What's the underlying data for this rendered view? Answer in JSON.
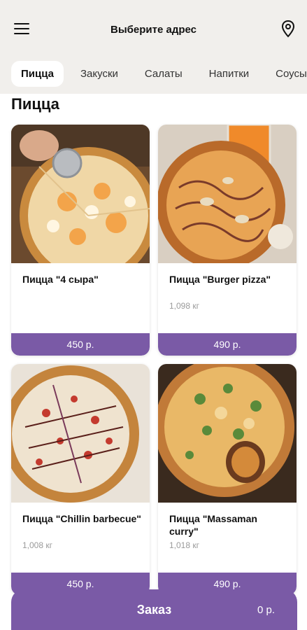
{
  "header": {
    "address_title": "Выберите адрес",
    "menu_icon": "hamburger-menu-icon",
    "pin_icon": "location-pin-icon"
  },
  "tabs": [
    {
      "label": "Пицца",
      "active": true
    },
    {
      "label": "Закуски",
      "active": false
    },
    {
      "label": "Салаты",
      "active": false
    },
    {
      "label": "Напитки",
      "active": false
    },
    {
      "label": "Соусы",
      "active": false
    }
  ],
  "section": {
    "title": "Пицца"
  },
  "products": [
    {
      "name": "Пицца \"4 сыра\"",
      "weight": "",
      "price": "450 р."
    },
    {
      "name": "Пицца \"Burger pizza\"",
      "weight": "1,098 кг",
      "price": "490 р."
    },
    {
      "name": "Пицца \"Chillin barbecue\"",
      "weight": "1,008 кг",
      "price": "450 р."
    },
    {
      "name": "Пицца \"Massaman curry\"",
      "weight": "1,018 кг",
      "price": "490 р."
    }
  ],
  "order": {
    "label": "Заказ",
    "total": "0 р."
  },
  "colors": {
    "accent": "#7a5aa6",
    "background": "#f1efec"
  }
}
